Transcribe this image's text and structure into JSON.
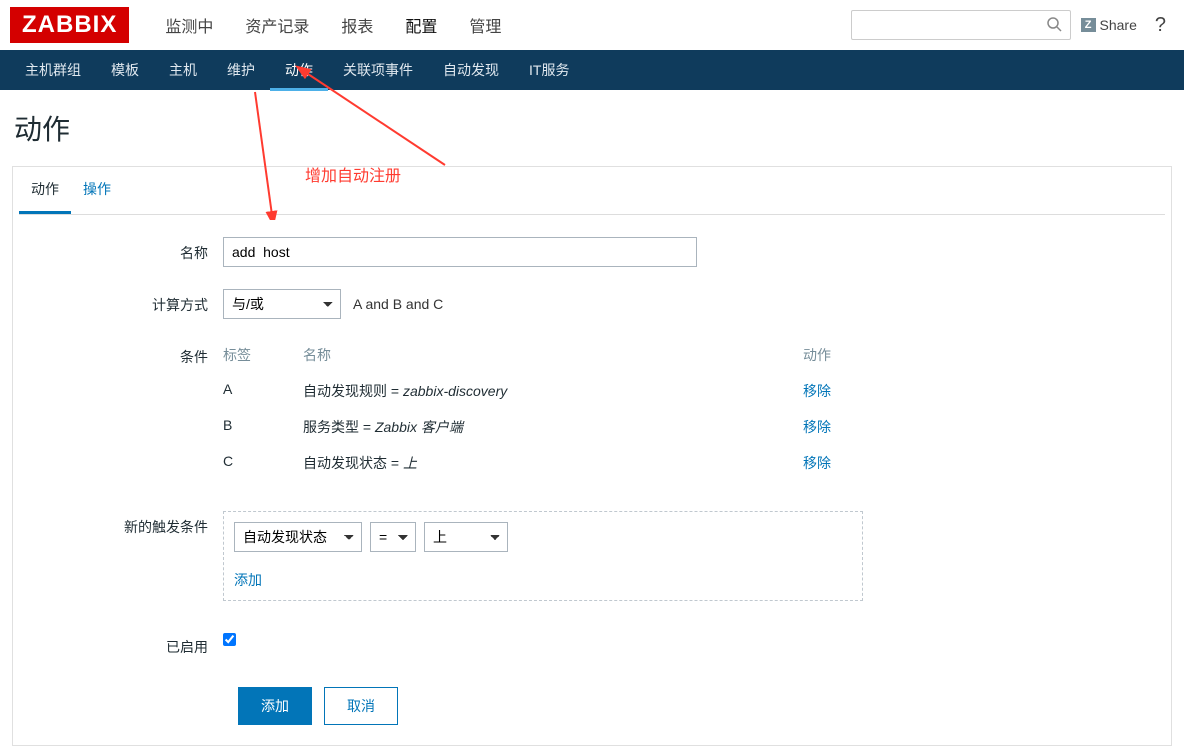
{
  "header": {
    "logo": "ZABBIX",
    "nav": [
      "监测中",
      "资产记录",
      "报表",
      "配置",
      "管理"
    ],
    "active_nav_index": 3,
    "share": "Share",
    "help": "?"
  },
  "subnav": {
    "items": [
      "主机群组",
      "模板",
      "主机",
      "维护",
      "动作",
      "关联项事件",
      "自动发现",
      "IT服务"
    ],
    "active_index": 4
  },
  "page": {
    "title": "动作"
  },
  "tabs": {
    "items": [
      "动作",
      "操作"
    ],
    "active_index": 0
  },
  "form": {
    "name_label": "名称",
    "name_value": "add  host",
    "calc_label": "计算方式",
    "calc_select": "与/或",
    "calc_expr": "A and B and C",
    "cond_label": "条件",
    "cond_headers": {
      "tag": "标签",
      "name": "名称",
      "action": "动作"
    },
    "conditions": [
      {
        "tag": "A",
        "prefix": "自动发现规则 = ",
        "italic": "zabbix-discovery",
        "action": "移除"
      },
      {
        "tag": "B",
        "prefix": "服务类型 = ",
        "italic": "Zabbix 客户端",
        "action": "移除"
      },
      {
        "tag": "C",
        "prefix": "自动发现状态 = ",
        "italic": "上",
        "action": "移除"
      }
    ],
    "newcond_label": "新的触发条件",
    "newcond_selects": [
      "自动发现状态",
      "=",
      "上"
    ],
    "add_link": "添加",
    "enabled_label": "已启用",
    "enabled": true,
    "btn_add": "添加",
    "btn_cancel": "取消"
  },
  "annotation": {
    "text": "增加自动注册"
  }
}
